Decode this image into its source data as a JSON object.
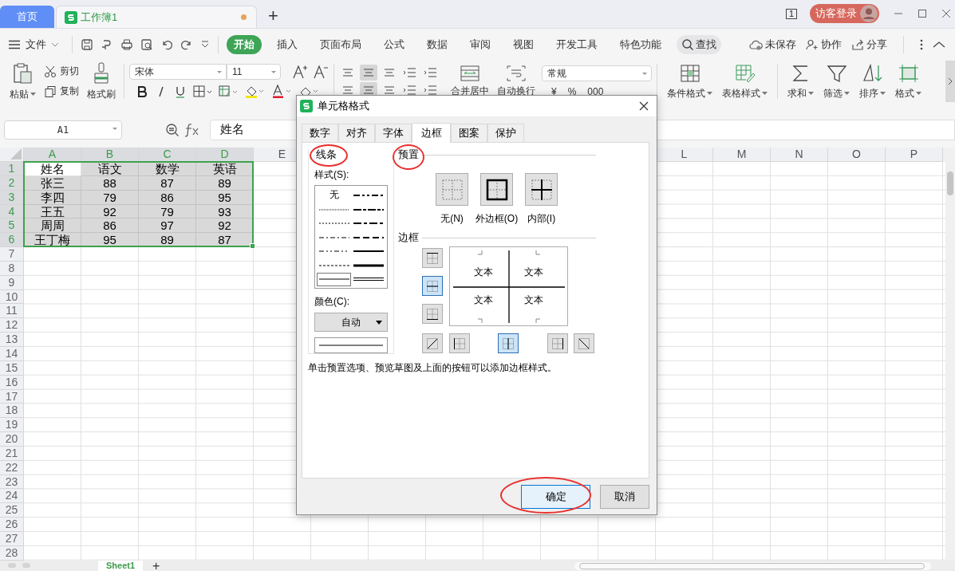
{
  "tab_bar": {
    "home": "首页",
    "document": {
      "title": "工作簿1",
      "unsaved": true
    },
    "new_tab": "+",
    "page_count": "1",
    "login": "访客登录"
  },
  "menu": {
    "file": "文件",
    "items": [
      {
        "label": "开始",
        "selected": true
      },
      {
        "label": "插入",
        "selected": false
      },
      {
        "label": "页面布局",
        "selected": false
      },
      {
        "label": "公式",
        "selected": false
      },
      {
        "label": "数据",
        "selected": false
      },
      {
        "label": "审阅",
        "selected": false
      },
      {
        "label": "视图",
        "selected": false
      },
      {
        "label": "开发工具",
        "selected": false
      },
      {
        "label": "特色功能",
        "selected": false
      }
    ],
    "search": "查找",
    "unsaved": "未保存",
    "collaborate": "协作",
    "share": "分享"
  },
  "ribbon": {
    "paste": "粘贴",
    "cut": "剪切",
    "copy": "复制",
    "format_painter": "格式刷",
    "font_name": "宋体",
    "font_size": "11",
    "merge": "合并居中",
    "wrap": "自动换行",
    "number_format": "常规",
    "number_buttons": [
      "¥",
      "%",
      "000"
    ],
    "tools": [
      "条件格式",
      "表格样式",
      "求和",
      "筛选",
      "排序",
      "格式"
    ]
  },
  "formula_bar": {
    "cell_ref": "A1",
    "value": "姓名"
  },
  "sheet": {
    "columns_left": [
      {
        "label": "A",
        "selected": true
      },
      {
        "label": "B",
        "selected": true
      },
      {
        "label": "C",
        "selected": true
      },
      {
        "label": "D",
        "selected": true
      },
      {
        "label": "E",
        "selected": false
      }
    ],
    "columns_right": [
      {
        "label": "L",
        "selected": false
      },
      {
        "label": "M",
        "selected": false
      },
      {
        "label": "N",
        "selected": false
      },
      {
        "label": "O",
        "selected": false
      },
      {
        "label": "P",
        "selected": false
      }
    ],
    "rows": [
      {
        "number": "1",
        "selected": true,
        "cells": [
          "姓名",
          "语文",
          "数学",
          "英语"
        ]
      },
      {
        "number": "2",
        "selected": true,
        "cells": [
          "张三",
          "88",
          "87",
          "89"
        ]
      },
      {
        "number": "3",
        "selected": true,
        "cells": [
          "李四",
          "79",
          "86",
          "95"
        ]
      },
      {
        "number": "4",
        "selected": true,
        "cells": [
          "王五",
          "92",
          "79",
          "93"
        ]
      },
      {
        "number": "5",
        "selected": true,
        "cells": [
          "周周",
          "86",
          "97",
          "92"
        ]
      },
      {
        "number": "6",
        "selected": true,
        "cells": [
          "王丁梅",
          "95",
          "89",
          "87"
        ]
      },
      {
        "number": "7",
        "selected": false
      },
      {
        "number": "8",
        "selected": false
      },
      {
        "number": "9",
        "selected": false
      },
      {
        "number": "10",
        "selected": false
      },
      {
        "number": "11",
        "selected": false
      },
      {
        "number": "12",
        "selected": false
      },
      {
        "number": "13",
        "selected": false
      },
      {
        "number": "14",
        "selected": false
      },
      {
        "number": "15",
        "selected": false
      },
      {
        "number": "16",
        "selected": false
      },
      {
        "number": "17",
        "selected": false
      },
      {
        "number": "18",
        "selected": false
      },
      {
        "number": "19",
        "selected": false
      },
      {
        "number": "20",
        "selected": false
      },
      {
        "number": "21",
        "selected": false
      },
      {
        "number": "22",
        "selected": false
      },
      {
        "number": "23",
        "selected": false
      },
      {
        "number": "24",
        "selected": false
      },
      {
        "number": "25",
        "selected": false
      },
      {
        "number": "26",
        "selected": false
      },
      {
        "number": "27",
        "selected": false
      },
      {
        "number": "28",
        "selected": false
      }
    ]
  },
  "sheet_tabs": [
    {
      "label": "Sheet1",
      "selected": true
    }
  ],
  "add_sheet": "+",
  "dialog": {
    "title": "单元格格式",
    "tabs": [
      {
        "label": "数字",
        "selected": false
      },
      {
        "label": "对齐",
        "selected": false
      },
      {
        "label": "字体",
        "selected": false
      },
      {
        "label": "边框",
        "selected": true
      },
      {
        "label": "图案",
        "selected": false
      },
      {
        "label": "保护",
        "selected": false
      }
    ],
    "line": {
      "heading": "线条",
      "circled": true,
      "style_label": "样式(S):",
      "styles": [
        {
          "kind": "none",
          "label": "无",
          "selected": false
        },
        {
          "kind": "hair",
          "selected": false
        },
        {
          "kind": "dotted",
          "selected": false
        },
        {
          "kind": "dashdot",
          "selected": false
        },
        {
          "kind": "dashdotdot",
          "selected": false
        },
        {
          "kind": "dashed",
          "selected": false
        },
        {
          "kind": "thin",
          "selected": true
        },
        {
          "kind": "med_dashdotdot",
          "selected": false
        },
        {
          "kind": "slant_dashdot",
          "selected": false
        },
        {
          "kind": "med_dashdot",
          "selected": false
        },
        {
          "kind": "med_dashed",
          "selected": false
        },
        {
          "kind": "medium",
          "selected": false
        },
        {
          "kind": "thick",
          "selected": false
        },
        {
          "kind": "double",
          "selected": false
        }
      ],
      "color_label": "颜色(C):",
      "color_value": "自动"
    },
    "presets": {
      "heading": "预置",
      "circled": true,
      "items": [
        {
          "kind": "none",
          "label": "无(N)"
        },
        {
          "kind": "outline",
          "label": "外边框(O)"
        },
        {
          "kind": "inside",
          "label": "内部(I)"
        }
      ]
    },
    "border": {
      "heading": "边框",
      "preview_texts": [
        "文本",
        "文本",
        "文本",
        "文本"
      ],
      "side_buttons": [
        {
          "kind": "top",
          "selected": false
        },
        {
          "kind": "middle",
          "selected": true
        },
        {
          "kind": "bottom",
          "selected": false
        }
      ],
      "bottom_buttons": [
        {
          "kind": "diag_up",
          "selected": false
        },
        {
          "kind": "left",
          "selected": false
        },
        {
          "kind": "center",
          "selected": true
        },
        {
          "kind": "right",
          "selected": false
        },
        {
          "kind": "diag_down",
          "selected": false
        }
      ]
    },
    "hint": "单击预置选项、预览草图及上面的按钮可以添加边框样式。",
    "buttons": [
      {
        "label": "确定",
        "primary": true,
        "circled": true
      },
      {
        "label": "取消",
        "primary": false,
        "circled": false
      }
    ]
  }
}
